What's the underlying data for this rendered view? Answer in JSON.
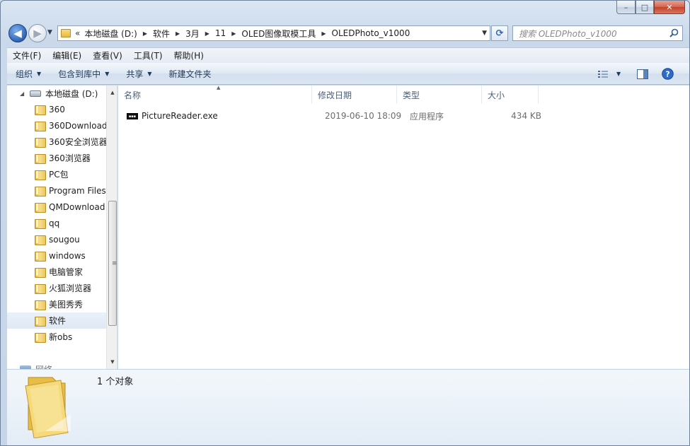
{
  "window": {
    "caption": {
      "minimize": "–",
      "maximize": "□",
      "close": "✕"
    }
  },
  "address": {
    "overflow": "«",
    "crumbs": [
      "本地磁盘 (D:)",
      "软件",
      "3月",
      "11",
      "OLED图像取模工具",
      "OLEDPhoto_v1000"
    ]
  },
  "search": {
    "placeholder": "搜索 OLEDPhoto_v1000"
  },
  "menu": [
    "文件(F)",
    "编辑(E)",
    "查看(V)",
    "工具(T)",
    "帮助(H)"
  ],
  "commands": {
    "organize": "组织",
    "include_library": "包含到库中",
    "share": "共享",
    "new_folder": "新建文件夹"
  },
  "nav": {
    "drive": "本地磁盘 (D:)",
    "folders": [
      "360",
      "360Download",
      "360安全浏览器",
      "360浏览器",
      "PC包",
      "Program Files",
      "QMDownload",
      "qq",
      "sougou",
      "windows",
      "电脑管家",
      "火狐浏览器",
      "美图秀秀",
      "软件",
      "新obs"
    ],
    "selected": "软件",
    "network_partial": "网络"
  },
  "columns": {
    "name": "名称",
    "date": "修改日期",
    "type": "类型",
    "size": "大小"
  },
  "files": [
    {
      "name": "PictureReader.exe",
      "date": "2019-06-10 18:09",
      "type": "应用程序",
      "size": "434 KB"
    }
  ],
  "details": {
    "count": "1 个对象"
  },
  "colors": {
    "accent": "#2f66b8",
    "folder": "#f0c94f",
    "selection": "#dfe8f4"
  }
}
